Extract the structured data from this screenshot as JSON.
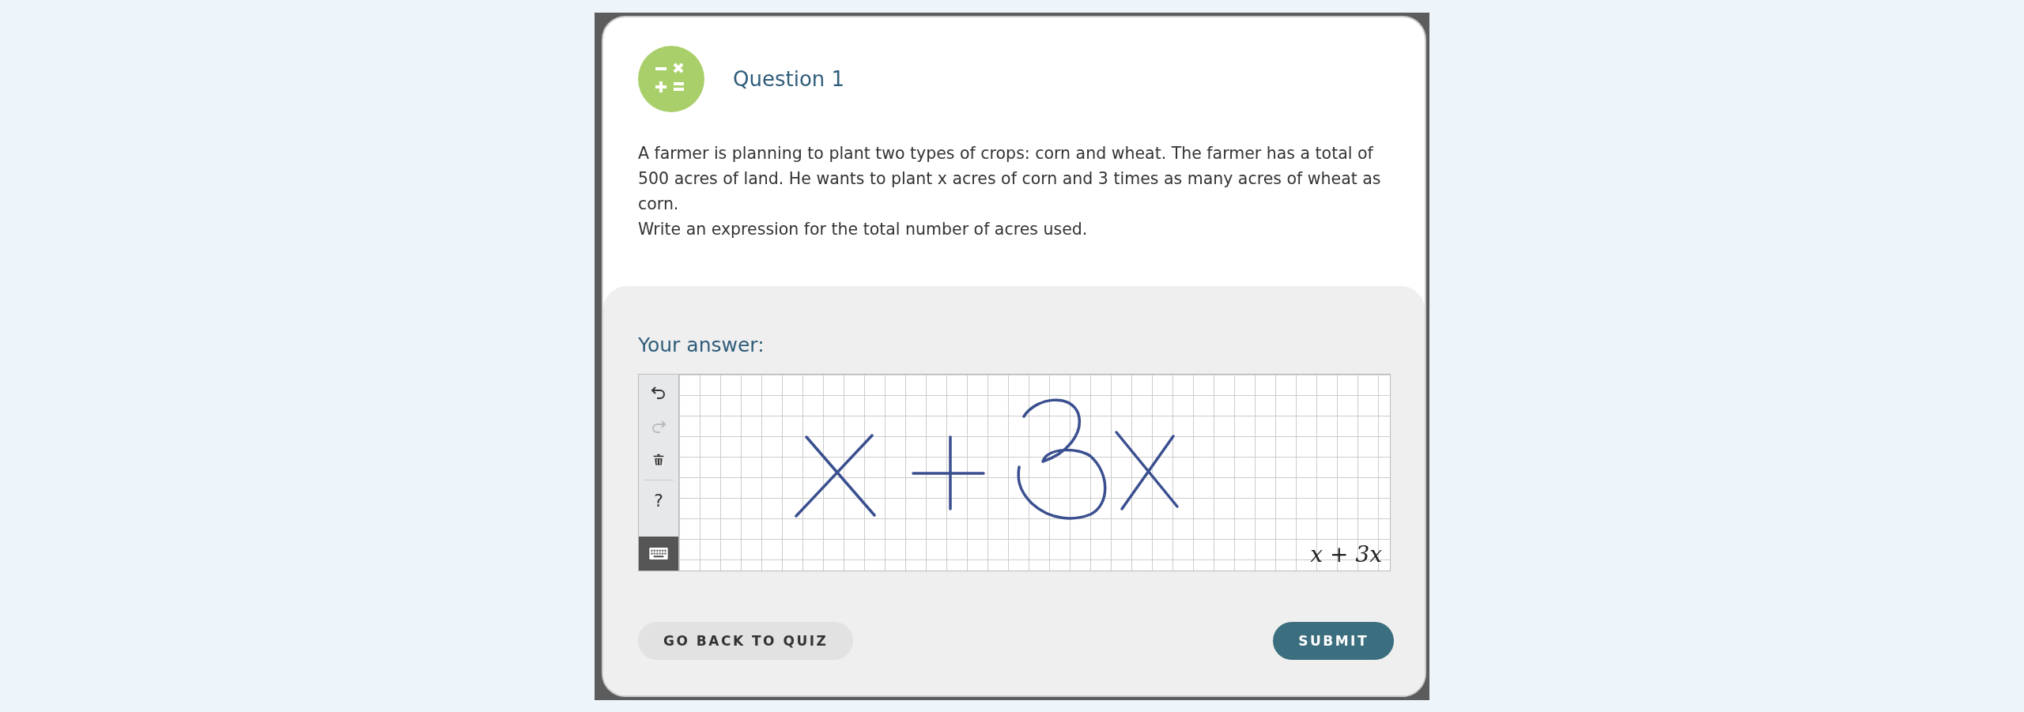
{
  "question": {
    "title": "Question 1",
    "paragraphs": [
      "A farmer is planning to plant two types of crops: corn and wheat. The farmer has a total of 500 acres of land. He wants to plant x acres of corn and 3 times as many acres of wheat as corn.",
      "Write an expression for the total number of acres used."
    ]
  },
  "answer": {
    "label": "Your answer:",
    "recognized": "x + 3x",
    "tools": [
      {
        "kind": "undo",
        "disabled": false,
        "selected": false
      },
      {
        "kind": "redo",
        "disabled": true,
        "selected": false
      },
      {
        "kind": "trash",
        "disabled": false,
        "selected": false
      },
      {
        "kind": "help",
        "label": "?",
        "disabled": false,
        "selected": false
      },
      {
        "kind": "keyboard",
        "disabled": false,
        "selected": true
      }
    ]
  },
  "buttons": [
    {
      "kind": "secondary",
      "label": "GO BACK TO QUIZ"
    },
    {
      "kind": "primary",
      "label": "SUBMIT"
    }
  ]
}
